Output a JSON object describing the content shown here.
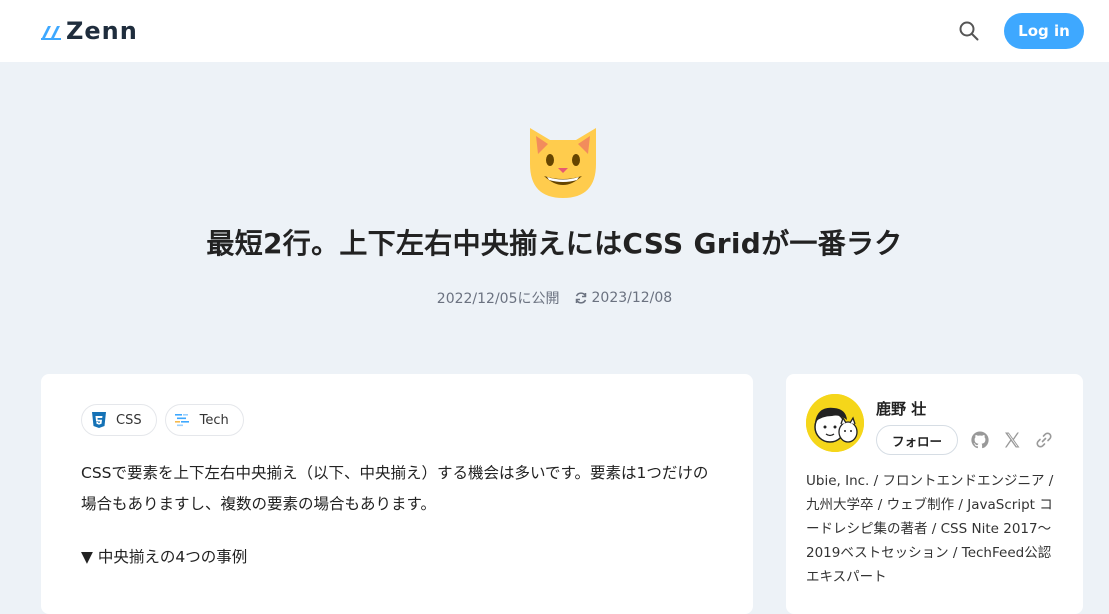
{
  "header": {
    "logo_text": "Zenn",
    "login_label": "Log in"
  },
  "article": {
    "title": "最短2行。上下左右中央揃えにはCSS Gridが一番ラク",
    "published": "2022/12/05に公開",
    "updated": "2023/12/08",
    "topics": [
      {
        "label": "CSS",
        "icon": "css3-icon"
      },
      {
        "label": "Tech",
        "icon": "tech-icon"
      }
    ],
    "paragraphs": [
      "CSSで要素を上下左右中央揃え（以下、中央揃え）する機会は多いです。要素は1つだけの場合もありますし、複数の要素の場合もあります。",
      "▼ 中央揃えの4つの事例"
    ]
  },
  "author": {
    "name": "鹿野 壮",
    "follow_label": "フォロー",
    "bio": "Ubie, Inc. / フロントエンドエンジニア / 九州大学卒 / ウェブ制作 / JavaScript コードレシピ集の著者 / CSS Nite 2017〜2019ベストセッション / TechFeed公認エキスパート"
  },
  "colors": {
    "accent": "#3ea8ff",
    "page_bg": "#edf2f7"
  }
}
